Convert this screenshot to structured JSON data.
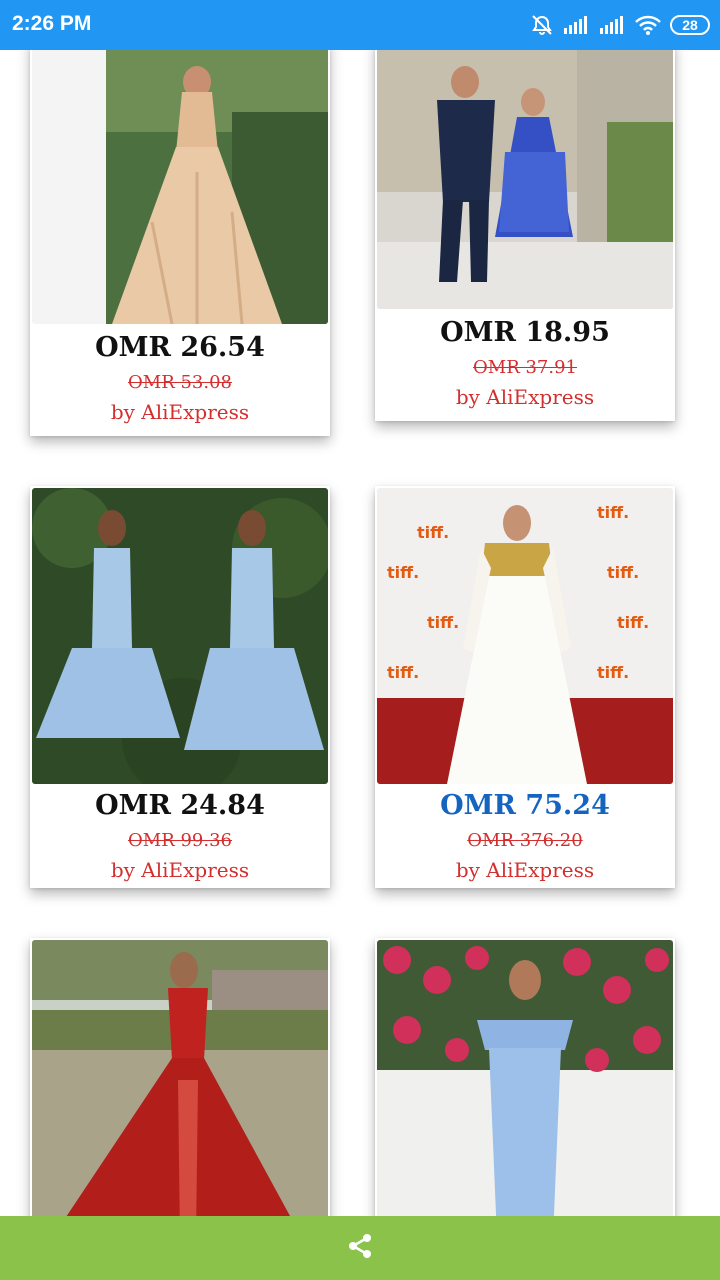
{
  "status_bar": {
    "time": "2:26 PM",
    "battery": "28",
    "icons": [
      "alarm-off-icon",
      "signal-icon",
      "signal-icon",
      "wifi-icon",
      "battery-icon"
    ]
  },
  "products": [
    {
      "price": "OMR 26.54",
      "old_price": "OMR 53.08",
      "seller": "by AliExpress",
      "image": "champagne ball gown"
    },
    {
      "price": "OMR 18.95",
      "old_price": "OMR 37.91",
      "seller": "by AliExpress",
      "image": "blue lace cocktail dress with suited man"
    },
    {
      "price": "OMR 24.84",
      "old_price": "OMR 99.36",
      "seller": "by AliExpress",
      "image": "light blue short satin dress front and back"
    },
    {
      "price": "OMR 75.24",
      "old_price": "OMR 376.20",
      "seller": "by AliExpress",
      "image": "white gown with gold embellished neckline"
    },
    {
      "price": "",
      "old_price": "",
      "seller": "",
      "image": "red satin gown with jumpsuit"
    },
    {
      "price": "",
      "old_price": "",
      "seller": "",
      "image": "blue sequin off-shoulder gown with roses"
    }
  ],
  "colors": {
    "status_bar": "#2196f3",
    "bottom_bar": "#8bc34a",
    "price_default": "#111111",
    "price_highlight": "#1565c0",
    "old_price": "#d32f2f",
    "seller": "#d32f2f"
  },
  "bottom_bar": {
    "icon": "share-icon"
  }
}
